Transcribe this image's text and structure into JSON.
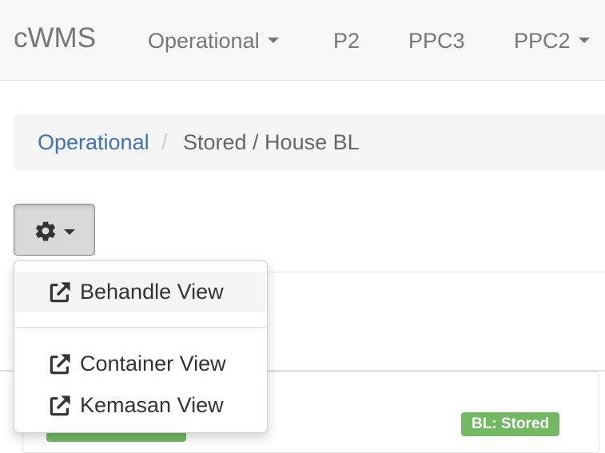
{
  "navbar": {
    "brand": "cWMS",
    "items": [
      {
        "label": "Operational",
        "has_caret": true
      },
      {
        "label": "P2",
        "has_caret": false
      },
      {
        "label": "PPC3",
        "has_caret": false
      },
      {
        "label": "PPC2",
        "has_caret": true
      }
    ]
  },
  "breadcrumb": {
    "separator": "/",
    "link": "Operational",
    "active": "Stored / House BL"
  },
  "actions": {
    "button_icon": "gear-icon"
  },
  "dropdown": {
    "items": [
      {
        "label": "Behandle View",
        "icon": "external-link-icon",
        "highlighted": true
      },
      {
        "label": "Container View",
        "icon": "external-link-icon",
        "highlighted": false
      },
      {
        "label": "Kemasan View",
        "icon": "external-link-icon",
        "highlighted": false
      }
    ]
  },
  "badges": {
    "bl_status": "BL: Stored"
  },
  "colors": {
    "link": "#3f72b8",
    "success": "#73b863",
    "navbar_bg": "#f8f8f8"
  }
}
